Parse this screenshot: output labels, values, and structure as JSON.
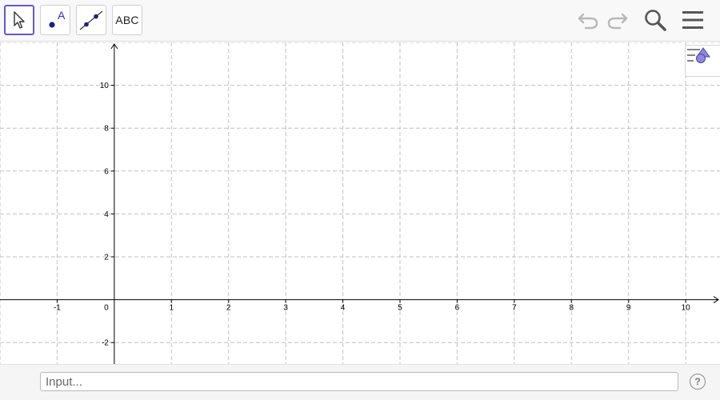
{
  "toolbar": {
    "tools": [
      {
        "name": "move",
        "icon": "cursor-arrow-icon",
        "active": true
      },
      {
        "name": "point",
        "icon": "point-icon",
        "label": "A"
      },
      {
        "name": "line",
        "icon": "line-through-two-points-icon"
      },
      {
        "name": "text",
        "icon": "text-icon",
        "label": "ABC"
      }
    ],
    "right_icons": [
      "undo-icon",
      "redo-icon",
      "search-icon",
      "menu-icon"
    ]
  },
  "graphics": {
    "style_bar_icon": "style-bar-toggle-icon",
    "x_axis": {
      "min": -2,
      "max": 10.6,
      "tick_labels": [
        "-1",
        "0",
        "1",
        "2",
        "3",
        "4",
        "5",
        "6",
        "7",
        "8",
        "9",
        "10"
      ],
      "grid_step": 1
    },
    "y_axis": {
      "min": -3.0,
      "max": 12.0,
      "tick_labels": [
        "-2",
        "2",
        "4",
        "6",
        "8",
        "10"
      ],
      "grid_step": 2
    },
    "grid": true,
    "colors": {
      "grid": "#c0c0c0",
      "axis": "#000000",
      "accent": "#6557d2",
      "point": "#1a237e"
    }
  },
  "input_bar": {
    "placeholder": "Input...",
    "help_label": "?"
  }
}
